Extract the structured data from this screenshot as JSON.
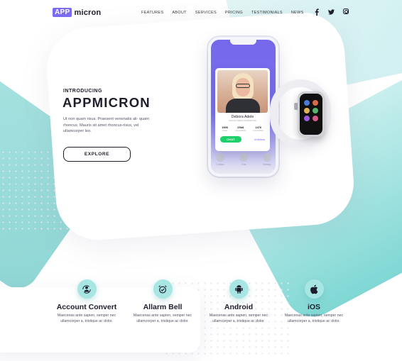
{
  "logo": {
    "box": "APP",
    "text": "micron"
  },
  "nav": {
    "items": [
      "FEATURES",
      "ABOUT",
      "SERVICES",
      "PRICING",
      "TESTIMONIALS",
      "NEWS"
    ]
  },
  "social": {
    "icons": [
      "facebook-icon",
      "twitter-icon",
      "instagram-icon"
    ]
  },
  "hero": {
    "intro": "INTRODUCING",
    "title": "APPMICRON",
    "description": "Ut non quam risus. Praesent venenatis ali- quam rhoncus. Mauris sit amet rhoncus-risus, vel ullamcorper leo.",
    "button": "EXPLORE"
  },
  "phone": {
    "profile": {
      "name": "Debora Adele",
      "role": "SOCIAL MEDIA MARKETING",
      "stats": [
        {
          "value": "1906",
          "label": "LIKES"
        },
        {
          "value": "25k8",
          "label": "FOLLOWERS"
        },
        {
          "value": "1476",
          "label": "FOLLOWING"
        }
      ],
      "chat_button": "CHAT",
      "unfollow": "Unfollow"
    },
    "dock": [
      "Contact",
      "Chat",
      "Settings"
    ]
  },
  "features": [
    {
      "title": "Account Convert",
      "icon": "account-convert-icon",
      "desc1": "Maecenas ante sapien, semper nec",
      "desc2": "ullamcorper a, tristique ac dolor."
    },
    {
      "title": "Allarm Bell",
      "icon": "alarm-clock-icon",
      "desc1": "Maecenas ante sapien, semper nec",
      "desc2": "ullamcorper a, tristique ac dolor."
    },
    {
      "title": "Android",
      "icon": "android-icon",
      "desc1": "Maecenas ante sapien, semper nec",
      "desc2": "ullamcorper a, tristique ac dolor."
    },
    {
      "title": "iOS",
      "icon": "apple-icon",
      "desc1": "Maecenas ante sapien, semper nec",
      "desc2": "ullamcorper a, tristique ac dolor."
    }
  ],
  "colors": {
    "accent": "#7b6bf0",
    "teal": "#a7e6e3",
    "dark": "#1d1d2b",
    "green": "#1fcf6a"
  }
}
